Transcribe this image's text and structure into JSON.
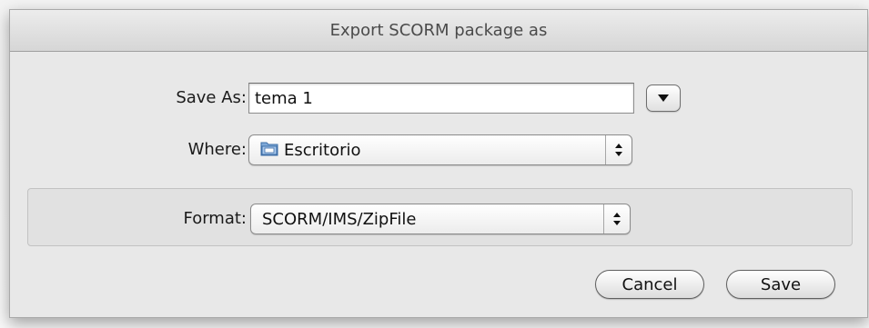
{
  "window": {
    "title": "Export SCORM package as"
  },
  "save_as": {
    "label": "Save As:",
    "value": "tema 1"
  },
  "where": {
    "label": "Where:",
    "selected": "Escritorio",
    "icon": "folder-icon"
  },
  "format": {
    "label": "Format:",
    "selected": "SCORM/IMS/ZipFile"
  },
  "buttons": {
    "cancel": "Cancel",
    "save": "Save"
  }
}
